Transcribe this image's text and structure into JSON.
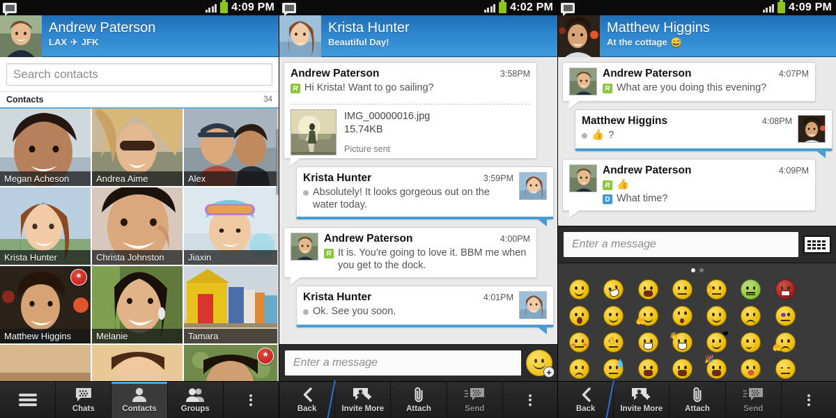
{
  "app": "BBM",
  "panels": [
    {
      "id": "contacts",
      "statusbar": {
        "icon": "bbm-logo-icon",
        "time": "4:09 PM",
        "battery": "battery-icon",
        "signal": "signal-icon"
      },
      "header": {
        "name": "Andrew Paterson",
        "status_from": "LAX",
        "status_to": "JFK",
        "status_icon": "airplane-icon",
        "avatar": "andrew-avatar"
      },
      "search": {
        "placeholder": "Search contacts",
        "value": ""
      },
      "list_header": {
        "title": "Contacts",
        "count": "34"
      },
      "contacts": [
        {
          "name": "Megan Acheson",
          "badge": ""
        },
        {
          "name": "Andrea Aime",
          "badge": ""
        },
        {
          "name": "Alex",
          "badge": ""
        },
        {
          "name": "Krista Hunter",
          "badge": ""
        },
        {
          "name": "Christa Johnston",
          "badge": ""
        },
        {
          "name": "Jiaxin",
          "badge": ""
        },
        {
          "name": "Matthew Higgins",
          "badge": "*"
        },
        {
          "name": "Melanie",
          "badge": ""
        },
        {
          "name": "Tamara",
          "badge": ""
        },
        {
          "name": "",
          "badge": ""
        },
        {
          "name": "",
          "badge": ""
        },
        {
          "name": "",
          "badge": "*"
        }
      ],
      "nav": [
        {
          "label": "",
          "icon": "menu-icon",
          "selected": false
        },
        {
          "label": "Chats",
          "icon": "bbm-chat-icon",
          "selected": false
        },
        {
          "label": "Contacts",
          "icon": "person-icon",
          "selected": true
        },
        {
          "label": "Groups",
          "icon": "people-icon",
          "selected": false
        },
        {
          "label": "",
          "icon": "overflow-icon",
          "selected": false
        }
      ]
    },
    {
      "id": "chat-krista",
      "statusbar": {
        "icon": "bbm-logo-icon",
        "time": "4:02 PM",
        "battery": "battery-icon",
        "signal": "signal-icon"
      },
      "header": {
        "name": "Krista Hunter",
        "status": "Beautiful Day!",
        "avatar": "krista-avatar"
      },
      "messages": [
        {
          "sender": "Andrew Paterson",
          "time": "3:58PM",
          "side": "me",
          "marker": "R",
          "text": "Hi Krista! Want to go sailing?",
          "attachment": {
            "thumb": "sailing-photo",
            "name": "IMG_00000016.jpg",
            "size": "15.74KB",
            "status": "Picture sent"
          }
        },
        {
          "sender": "Krista Hunter",
          "time": "3:59PM",
          "side": "them",
          "marker": "dot",
          "text": "Absolutely! It looks gorgeous out on the water today.",
          "avatar": "krista-avatar"
        },
        {
          "sender": "Andrew Paterson",
          "time": "4:00PM",
          "side": "me",
          "marker": "R",
          "text": "It is. You're going to love it. BBM me when you get to the dock.",
          "avatar": "andrew-avatar"
        },
        {
          "sender": "Krista Hunter",
          "time": "4:01PM",
          "side": "them",
          "marker": "dot",
          "text": "Ok. See you soon.",
          "avatar": "krista-avatar"
        }
      ],
      "input": {
        "placeholder": "Enter a message",
        "value": "",
        "button": "smiley-add-icon"
      },
      "nav": [
        {
          "label": "Back",
          "icon": "chevron-left-icon",
          "dim": false
        },
        {
          "label": "Invite More",
          "icon": "invite-person-icon",
          "dim": false
        },
        {
          "label": "Attach",
          "icon": "paperclip-icon",
          "dim": false
        },
        {
          "label": "Send",
          "icon": "bbm-send-icon",
          "dim": true
        },
        {
          "label": "",
          "icon": "overflow-icon",
          "dim": false
        }
      ]
    },
    {
      "id": "chat-matthew",
      "statusbar": {
        "icon": "bbm-logo-icon",
        "time": "4:09 PM",
        "battery": "battery-icon",
        "signal": "signal-icon"
      },
      "header": {
        "name": "Matthew Higgins",
        "status": "At the cottage",
        "status_emoji": "😅",
        "avatar": "matthew-avatar"
      },
      "messages": [
        {
          "sender": "Andrew Paterson",
          "time": "4:07PM",
          "side": "me",
          "marker": "R",
          "text": "What are you doing this evening?",
          "avatar": "andrew-avatar"
        },
        {
          "sender": "Matthew Higgins",
          "time": "4:08PM",
          "side": "them",
          "marker": "dot",
          "text": "?",
          "emoji": "thumbs-up-icon",
          "avatar": "matthew-avatar"
        },
        {
          "sender": "Andrew Paterson",
          "time": "4:09PM",
          "side": "me",
          "marker": "R",
          "text": "",
          "emoji": "thumbs-up-icon",
          "marker2": "D",
          "text2": "What time?",
          "avatar": "andrew-avatar"
        }
      ],
      "input": {
        "placeholder": "Enter a message",
        "value": "",
        "button": "keyboard-icon"
      },
      "emoji_pager": {
        "pages": 2,
        "active": 1
      },
      "emoji_rows": [
        [
          "smile",
          "laugh-tilt",
          "tongue-wink",
          "neutral",
          "facepalm",
          "sick",
          "angry",
          "surprised"
        ],
        [
          "smile",
          "shy-hands",
          "eyes-up",
          "content",
          "worried",
          "bruised",
          "blush",
          "whistle"
        ],
        [
          "grin",
          "wave-laugh",
          "kiss-heart",
          "smirk",
          "scared-hands",
          "frown",
          "sweat-nervous",
          "yawn"
        ],
        [
          "big-grin",
          "party",
          "kiss",
          "relieved",
          "uncertain",
          "crying",
          "confused",
          "speechless"
        ]
      ],
      "nav": [
        {
          "label": "Back",
          "icon": "chevron-left-icon",
          "dim": false
        },
        {
          "label": "Invite More",
          "icon": "invite-person-icon",
          "dim": false
        },
        {
          "label": "Attach",
          "icon": "paperclip-icon",
          "dim": false
        },
        {
          "label": "Send",
          "icon": "bbm-send-icon",
          "dim": true
        },
        {
          "label": "",
          "icon": "overflow-icon",
          "dim": false
        }
      ]
    }
  ],
  "colors": {
    "accent": "#3f9ad8",
    "header_blue_dark": "#1f6fb5",
    "badge_red": "#b81d18",
    "marker_green": "#8cc63e",
    "nav_dark": "#2b2b2b"
  }
}
